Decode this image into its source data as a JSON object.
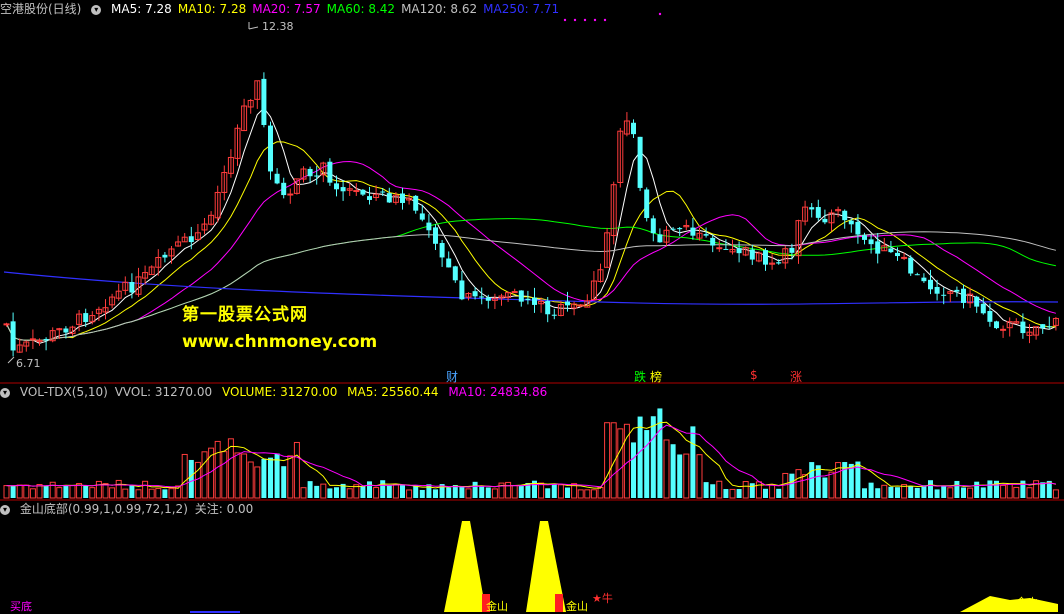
{
  "main_panel": {
    "stock_title": "空港股份(日线)",
    "indicators": [
      {
        "label": "MA5: 7.28",
        "color": "#ffffff"
      },
      {
        "label": "MA10: 7.28",
        "color": "#ffff00"
      },
      {
        "label": "MA20: 7.57",
        "color": "#ff00ff"
      },
      {
        "label": "MA60: 8.42",
        "color": "#00ff00"
      },
      {
        "label": "MA120: 8.62",
        "color": "#c0c0c0"
      },
      {
        "label": "MA250: 7.71",
        "color": "#3030ff"
      }
    ],
    "high_label": "12.38",
    "low_label": "6.71",
    "watermark_cn": "第一股票公式网",
    "watermark_url": "www.chnmoney.com",
    "events": [
      {
        "text": "财",
        "color": "#4aa3ff"
      },
      {
        "text": "跌",
        "color": "#00ff00"
      },
      {
        "text": "榜",
        "color": "#ffff00"
      },
      {
        "text": "$",
        "color": "#ff3030"
      },
      {
        "text": "涨",
        "color": "#ff3030"
      }
    ]
  },
  "volume_panel": {
    "name": "VOL-TDX(5,10)",
    "vvol": "VVOL: 31270.00",
    "volume": "VOLUME: 31270.00",
    "ma5": "MA5: 25560.44",
    "ma10": "MA10: 24834.86",
    "colors": {
      "name": "#c0c0c0",
      "volume": "#ffff00",
      "ma5": "#ffff00",
      "ma10": "#ff00ff"
    }
  },
  "indicator_panel": {
    "name": "金山底部(0.99,1,0.99,72,1,2)",
    "focus": "关注: 0.00",
    "bottom_labels": [
      {
        "text": "买底",
        "color": "#ff00ff"
      },
      {
        "text": "金山",
        "color": "#ffff00"
      },
      {
        "text": "金山",
        "color": "#ffff00"
      },
      {
        "text": "金山",
        "color": "#ffff00"
      },
      {
        "text": "★牛",
        "color": "#ff3030"
      }
    ]
  },
  "colors": {
    "up": "#ff3c3c",
    "down": "#54ffff",
    "bg": "#000000",
    "divider": "#b00000"
  }
}
